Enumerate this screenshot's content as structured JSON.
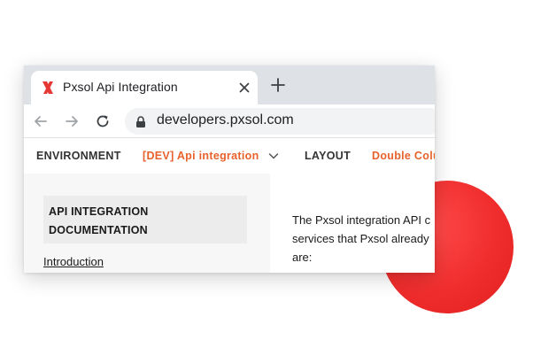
{
  "browser": {
    "tab": {
      "title": "Pxsol Api Integration"
    },
    "address_bar": {
      "url": "developers.pxsol.com"
    }
  },
  "app_nav": {
    "environment_label": "ENVIRONMENT",
    "environment_value": "[DEV] Api integration",
    "layout_label": "LAYOUT",
    "layout_value": "Double Colu"
  },
  "sidebar": {
    "doc_title_lines": [
      "API INTEGRATION",
      "DOCUMENTATION"
    ],
    "links": [
      "Introduction"
    ]
  },
  "content": {
    "lines": [
      "The Pxsol integration API c",
      "services that Pxsol already",
      "are:"
    ]
  },
  "colors": {
    "accent": "#e8622c",
    "brand_red": "#f02d2d",
    "favicon_red": "#e53935"
  },
  "icons": [
    "pxsol-logo-icon",
    "close-icon",
    "plus-icon",
    "back-arrow-icon",
    "forward-arrow-icon",
    "reload-icon",
    "lock-icon",
    "chevron-down-icon"
  ]
}
